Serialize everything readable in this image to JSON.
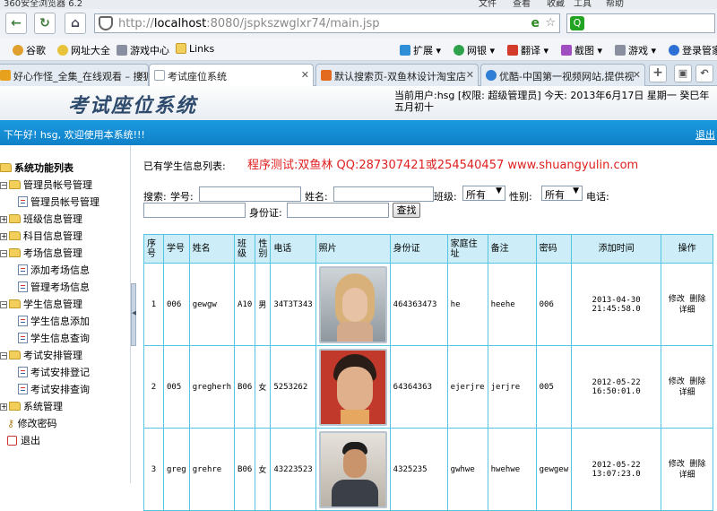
{
  "browser": {
    "name": "360安全浏览器 6.2",
    "menu": [
      "文件",
      "查看",
      "收藏",
      "工具",
      "帮助"
    ],
    "url_prefix": "http://",
    "url_host": "localhost",
    "url_rest": ":8080/jspkszwglxr74/main.jsp",
    "bookmarks": [
      "谷歌",
      "网址大全",
      "游戏中心",
      "Links"
    ],
    "toolbar": [
      "扩展",
      "网银",
      "翻译",
      "截图",
      "游戏",
      "登录管家"
    ],
    "tabs": [
      {
        "label": "好心作怪_全集_在线观看 – 搜狐",
        "active": false,
        "icon_color": "#e8a11d"
      },
      {
        "label": "考试座位系统",
        "active": true,
        "icon_color": "#9aa9b8"
      },
      {
        "label": "默认搜索页-双鱼林设计淘宝店",
        "active": false,
        "icon_color": "#e36b1f"
      },
      {
        "label": "优酷-中国第一视频网站,提供视",
        "active": false,
        "icon_color": "#2f7fd6"
      }
    ]
  },
  "app": {
    "title": "考试座位系统",
    "user_info": "当前用户:hsg [权限: 超级管理员] 今天: 2013年6月17日 星期一 癸巳年 五月初十",
    "welcome": "下午好! hsg, 欢迎使用本系统!!!",
    "logout": "退出"
  },
  "sidebar": {
    "root": "系统功能列表",
    "items": [
      {
        "label": "管理员帐号管理",
        "level": 1,
        "kind": "folder",
        "sign": "−"
      },
      {
        "label": "管理员帐号管理",
        "level": 2,
        "kind": "doc"
      },
      {
        "label": "班级信息管理",
        "level": 1,
        "kind": "folder",
        "sign": "+"
      },
      {
        "label": "科目信息管理",
        "level": 1,
        "kind": "folder",
        "sign": "+"
      },
      {
        "label": "考场信息管理",
        "level": 1,
        "kind": "folder",
        "sign": "−"
      },
      {
        "label": "添加考场信息",
        "level": 2,
        "kind": "doc"
      },
      {
        "label": "管理考场信息",
        "level": 2,
        "kind": "doc"
      },
      {
        "label": "学生信息管理",
        "level": 1,
        "kind": "folder",
        "sign": "−"
      },
      {
        "label": "学生信息添加",
        "level": 2,
        "kind": "doc"
      },
      {
        "label": "学生信息查询",
        "level": 2,
        "kind": "doc"
      },
      {
        "label": "考试安排管理",
        "level": 1,
        "kind": "folder",
        "sign": "−"
      },
      {
        "label": "考试安排登记",
        "level": 2,
        "kind": "doc"
      },
      {
        "label": "考试安排查询",
        "level": 2,
        "kind": "doc"
      },
      {
        "label": "系统管理",
        "level": 1,
        "kind": "folder",
        "sign": "+"
      },
      {
        "label": "修改密码",
        "level": 1,
        "kind": "key"
      },
      {
        "label": "退出",
        "level": 1,
        "kind": "exit"
      }
    ]
  },
  "main": {
    "list_label": "已有学生信息列表:",
    "promo": "程序测试:双鱼林 QQ:287307421或254540457 www.shuangyulin.com",
    "search": {
      "label": "搜索:",
      "student_no": "学号:",
      "name": "姓名:",
      "class": "班级:",
      "class_value": "所有",
      "gender": "性别:",
      "gender_value": "所有",
      "phone": "电话:",
      "idcard": "身份证:",
      "find": "查找"
    },
    "columns": [
      "序号",
      "学号",
      "姓名",
      "班级",
      "性别",
      "电话",
      "照片",
      "身份证",
      "家庭住址",
      "备注",
      "密码",
      "添加时间",
      "操作"
    ],
    "rows": [
      {
        "seq": "1",
        "no": "006",
        "name": "gewgw",
        "cls": "A10",
        "gender": "男",
        "phone": "34T3T343",
        "photo": "woman-photo",
        "idcard": "464363473",
        "addr": "he",
        "note": "heehe",
        "pwd": "006",
        "time": "2013-04-30 21:45:58.0"
      },
      {
        "seq": "2",
        "no": "005",
        "name": "gregherh",
        "cls": "B06",
        "gender": "女",
        "phone": "5253262",
        "photo": "man-photo",
        "idcard": "64364363",
        "addr": "ejerjre",
        "note": "jerjre",
        "pwd": "005",
        "time": "2012-05-22 16:50:01.0"
      },
      {
        "seq": "3",
        "no": "greg",
        "name": "grehre",
        "cls": "B06",
        "gender": "女",
        "phone": "43223523",
        "photo": "man-photo-2",
        "idcard": "4325235",
        "addr": "gwhwe",
        "note": "hwehwe",
        "pwd": "gewgew",
        "time": "2012-05-22 13:07:23.0"
      }
    ],
    "op_edit": "修改",
    "op_delete": "删除",
    "op_detail": "详细"
  }
}
